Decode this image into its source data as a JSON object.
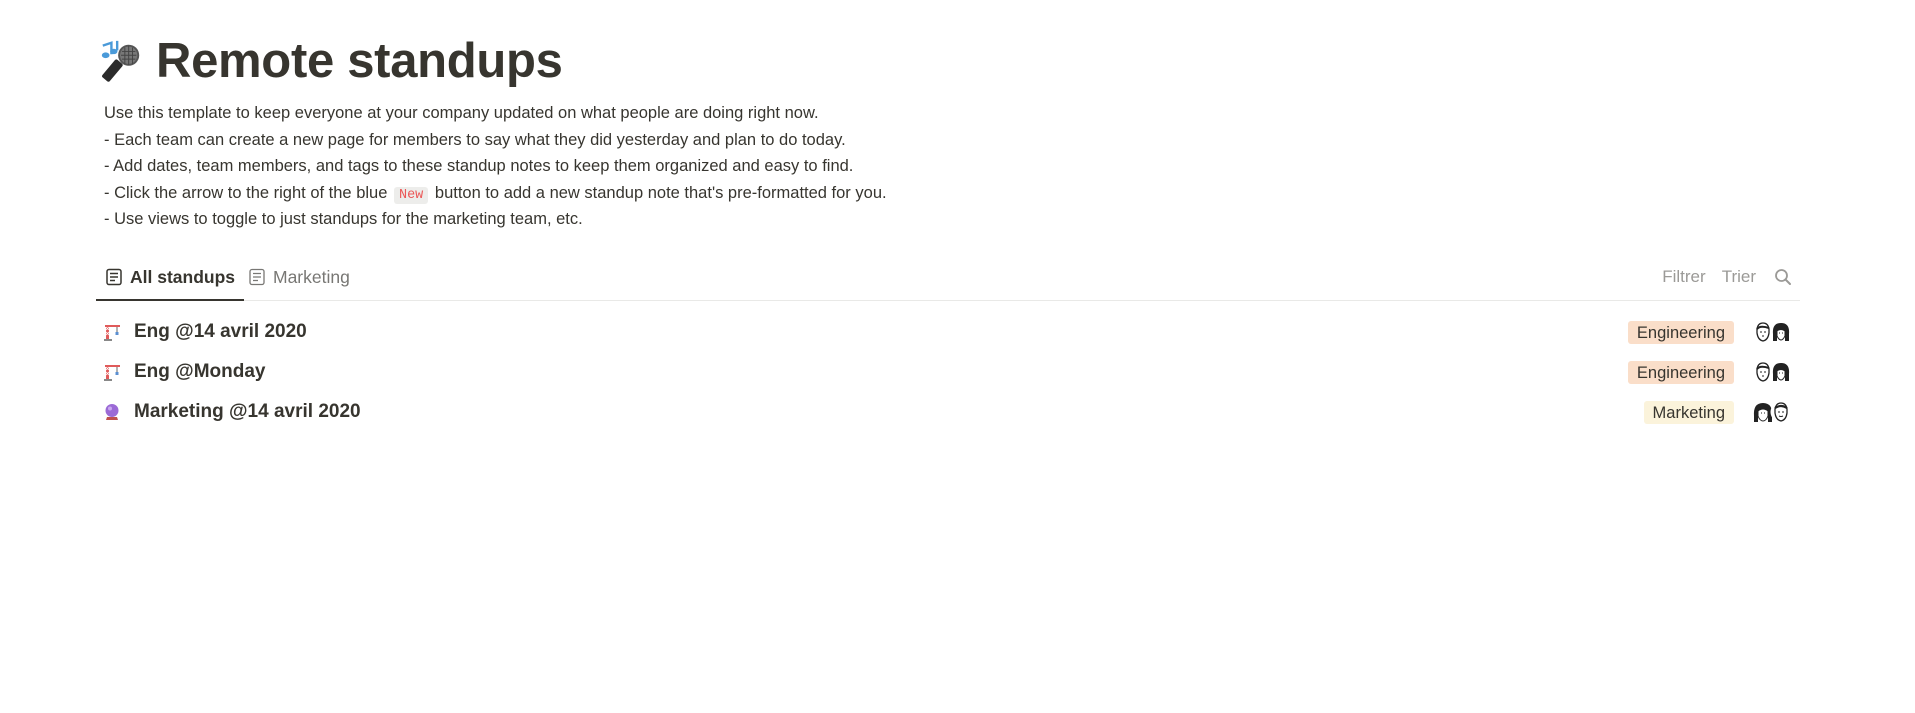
{
  "page": {
    "title_icon": "microphone-notes-icon",
    "title": "Remote standups",
    "description": {
      "line1": "Use this template to keep everyone at your company updated on what people are doing right now.",
      "line2": "- Each team can create a new page for members to say what they did yesterday and plan to do today.",
      "line3": "- Add dates, team members, and tags to these standup notes to keep them organized and easy to find.",
      "line4_before": "- Click the arrow to the right of the blue",
      "line4_code": "New",
      "line4_after": "button to add a new standup note that's pre-formatted for you.",
      "line5": "- Use views to toggle to just standups for the marketing team, etc."
    }
  },
  "views": {
    "tabs": [
      {
        "label": "All standups",
        "icon": "page-icon",
        "active": true
      },
      {
        "label": "Marketing",
        "icon": "page-icon",
        "active": false
      }
    ],
    "toolbar": {
      "filter_label": "Filtrer",
      "sort_label": "Trier",
      "search_icon": "search-icon"
    }
  },
  "rows": [
    {
      "title": "Eng @14 avril 2020",
      "icon": "crane-icon",
      "tag": "Engineering",
      "tag_color": "#fadec9",
      "avatars": [
        "person-avatar",
        "person-avatar"
      ]
    },
    {
      "title": "Eng @Monday",
      "icon": "crane-icon",
      "tag": "Engineering",
      "tag_color": "#fadec9",
      "avatars": [
        "person-avatar",
        "person-avatar"
      ]
    },
    {
      "title": "Marketing @14 avril 2020",
      "icon": "crystal-ball-icon",
      "tag": "Marketing",
      "tag_color": "#fbf3db",
      "avatars": [
        "person-avatar",
        "person-avatar"
      ]
    }
  ],
  "colors": {
    "text": "#37352f",
    "muted": "#9b9a97",
    "inline_code": "#eb5757",
    "engineering_tag": "#fadec9",
    "marketing_tag": "#fbf3db"
  }
}
